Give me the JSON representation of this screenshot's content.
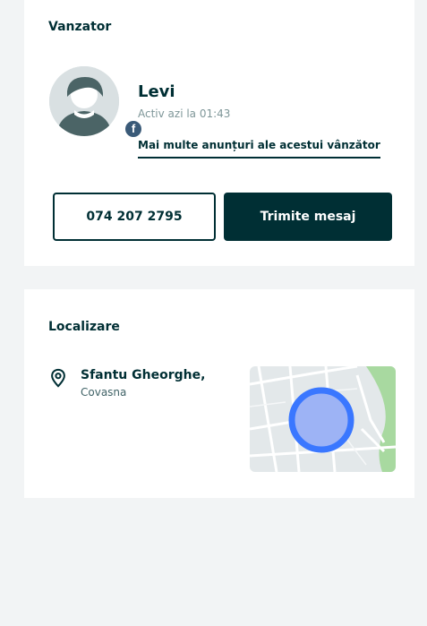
{
  "seller": {
    "section_title": "Vanzator",
    "name": "Levi",
    "last_active": "Activ azi la 01:43",
    "more_ads_link": "Mai multe anunțuri ale acestui vânzător",
    "phone_button": "074 207 2795",
    "message_button": "Trimite mesaj",
    "social_badge_icon": "facebook-icon"
  },
  "location": {
    "section_title": "Localizare",
    "city": "Sfantu Gheorghe,",
    "region": "Covasna",
    "icon": "map-pin-icon"
  },
  "colors": {
    "primary": "#002f34",
    "background": "#f2f4f5",
    "map_circle": "#3a77ff"
  }
}
